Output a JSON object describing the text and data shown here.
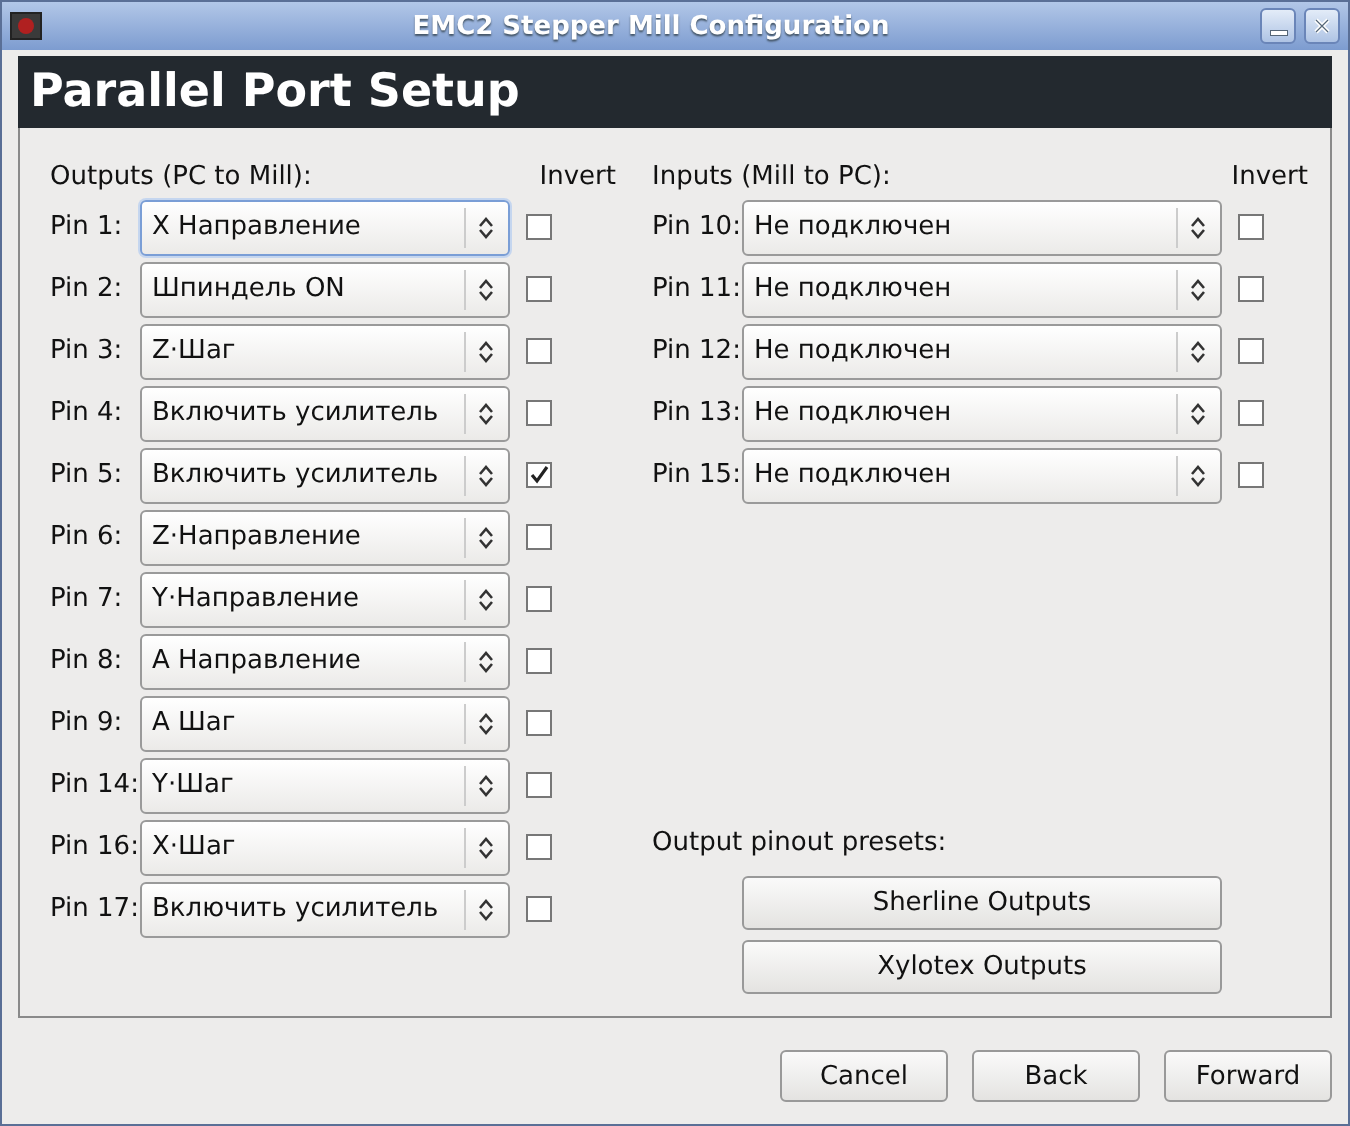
{
  "window": {
    "title": "EMC2 Stepper Mill Configuration"
  },
  "header": {
    "title": "Parallel Port Setup"
  },
  "outputs": {
    "heading": "Outputs (PC to Mill):",
    "invert_heading": "Invert",
    "pins": [
      {
        "label": "Pin 1:",
        "value": "X Направление",
        "focused": true,
        "invert": false
      },
      {
        "label": "Pin 2:",
        "value": "Шпиндель ON",
        "focused": false,
        "invert": false
      },
      {
        "label": "Pin 3:",
        "value": "Z·Шаг",
        "focused": false,
        "invert": false
      },
      {
        "label": "Pin 4:",
        "value": "Включить усилитель",
        "focused": false,
        "invert": false
      },
      {
        "label": "Pin 5:",
        "value": "Включить усилитель",
        "focused": false,
        "invert": true
      },
      {
        "label": "Pin 6:",
        "value": "Z·Направление",
        "focused": false,
        "invert": false
      },
      {
        "label": "Pin 7:",
        "value": "Y·Направление",
        "focused": false,
        "invert": false
      },
      {
        "label": "Pin 8:",
        "value": "A Направление",
        "focused": false,
        "invert": false
      },
      {
        "label": "Pin 9:",
        "value": "A Шаг",
        "focused": false,
        "invert": false
      },
      {
        "label": "Pin 14:",
        "value": "Y·Шаг",
        "focused": false,
        "invert": false
      },
      {
        "label": "Pin 16:",
        "value": "X·Шаг",
        "focused": false,
        "invert": false
      },
      {
        "label": "Pin 17:",
        "value": "Включить усилитель",
        "focused": false,
        "invert": false
      }
    ]
  },
  "inputs": {
    "heading": "Inputs (Mill to PC):",
    "invert_heading": "Invert",
    "pins": [
      {
        "label": "Pin 10:",
        "value": "Не подключен",
        "focused": false,
        "invert": false
      },
      {
        "label": "Pin 11:",
        "value": "Не подключен",
        "focused": false,
        "invert": false
      },
      {
        "label": "Pin 12:",
        "value": "Не подключен",
        "focused": false,
        "invert": false
      },
      {
        "label": "Pin 13:",
        "value": "Не подключен",
        "focused": false,
        "invert": false
      },
      {
        "label": "Pin 15:",
        "value": "Не подключен",
        "focused": false,
        "invert": false
      }
    ]
  },
  "presets": {
    "heading": "Output pinout presets:",
    "buttons": [
      "Sherline Outputs",
      "Xylotex Outputs"
    ]
  },
  "buttons": [
    "Cancel",
    "Back",
    "Forward"
  ]
}
